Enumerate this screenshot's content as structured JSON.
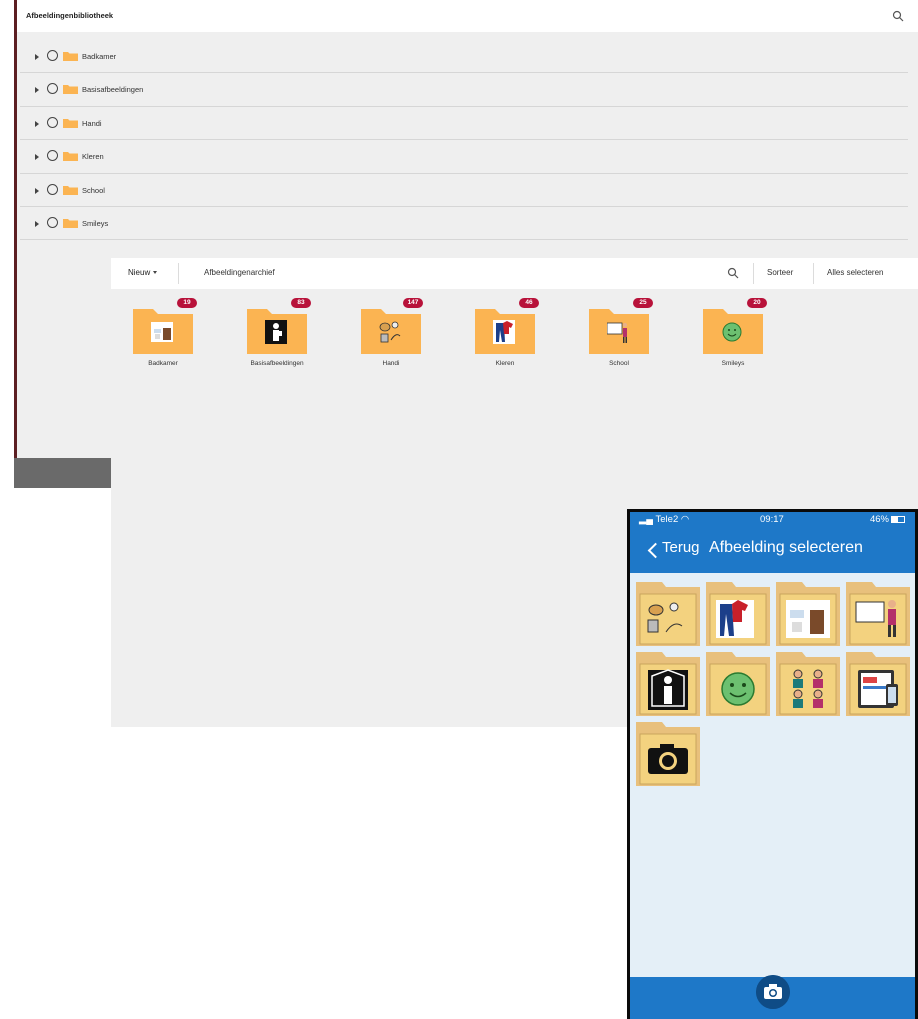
{
  "library": {
    "title": "Afbeeldingenbibliotheek",
    "search_icon": "search-icon",
    "items": [
      {
        "label": "Badkamer"
      },
      {
        "label": "Basisafbeeldingen"
      },
      {
        "label": "Handi"
      },
      {
        "label": "Kleren"
      },
      {
        "label": "School"
      },
      {
        "label": "Smileys"
      }
    ]
  },
  "archive": {
    "new_label": "Nieuw",
    "name": "Afbeeldingenarchief",
    "sort_label": "Sorteer",
    "select_all_label": "Alles selecteren",
    "folders": [
      {
        "label": "Badkamer",
        "count": "19"
      },
      {
        "label": "Basisafbeeldingen",
        "count": "83"
      },
      {
        "label": "Handi",
        "count": "147"
      },
      {
        "label": "Kleren",
        "count": "46"
      },
      {
        "label": "School",
        "count": "25"
      },
      {
        "label": "Smileys",
        "count": "20"
      }
    ]
  },
  "phone": {
    "carrier": "Tele2",
    "time": "09:17",
    "battery": "46%",
    "back_label": "Terug",
    "title": "Afbeelding selecteren"
  },
  "colors": {
    "folder": "#fbb452",
    "badge": "#b8123a",
    "phone_blue": "#1e78c8"
  }
}
